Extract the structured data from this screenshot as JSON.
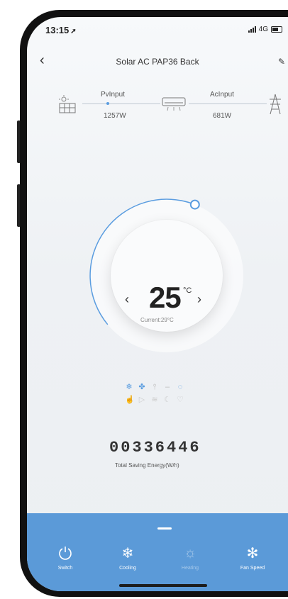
{
  "status": {
    "time": "13:15",
    "network": "4G"
  },
  "nav": {
    "title": "Solar AC PAP36 Back"
  },
  "flow": {
    "pv_label": "PvInput",
    "pv_value": "1257W",
    "ac_label": "AcInput",
    "ac_value": "681W"
  },
  "thermostat": {
    "temperature": "25",
    "unit": "°C",
    "current": "Current:29°C",
    "arc_fraction": 0.42
  },
  "energy": {
    "counter": "00336446",
    "label": "Total Saving Energy(W/h)"
  },
  "controls": [
    {
      "label": "Switch",
      "icon": "power-icon",
      "disabled": false
    },
    {
      "label": "Cooling",
      "icon": "snowflake-icon",
      "disabled": false
    },
    {
      "label": "Heating",
      "icon": "sun-icon",
      "disabled": true
    },
    {
      "label": "Fan Speed",
      "icon": "fan-icon",
      "disabled": false
    }
  ],
  "colors": {
    "accent": "#5b9ad8",
    "arc": "#5b9de0"
  }
}
